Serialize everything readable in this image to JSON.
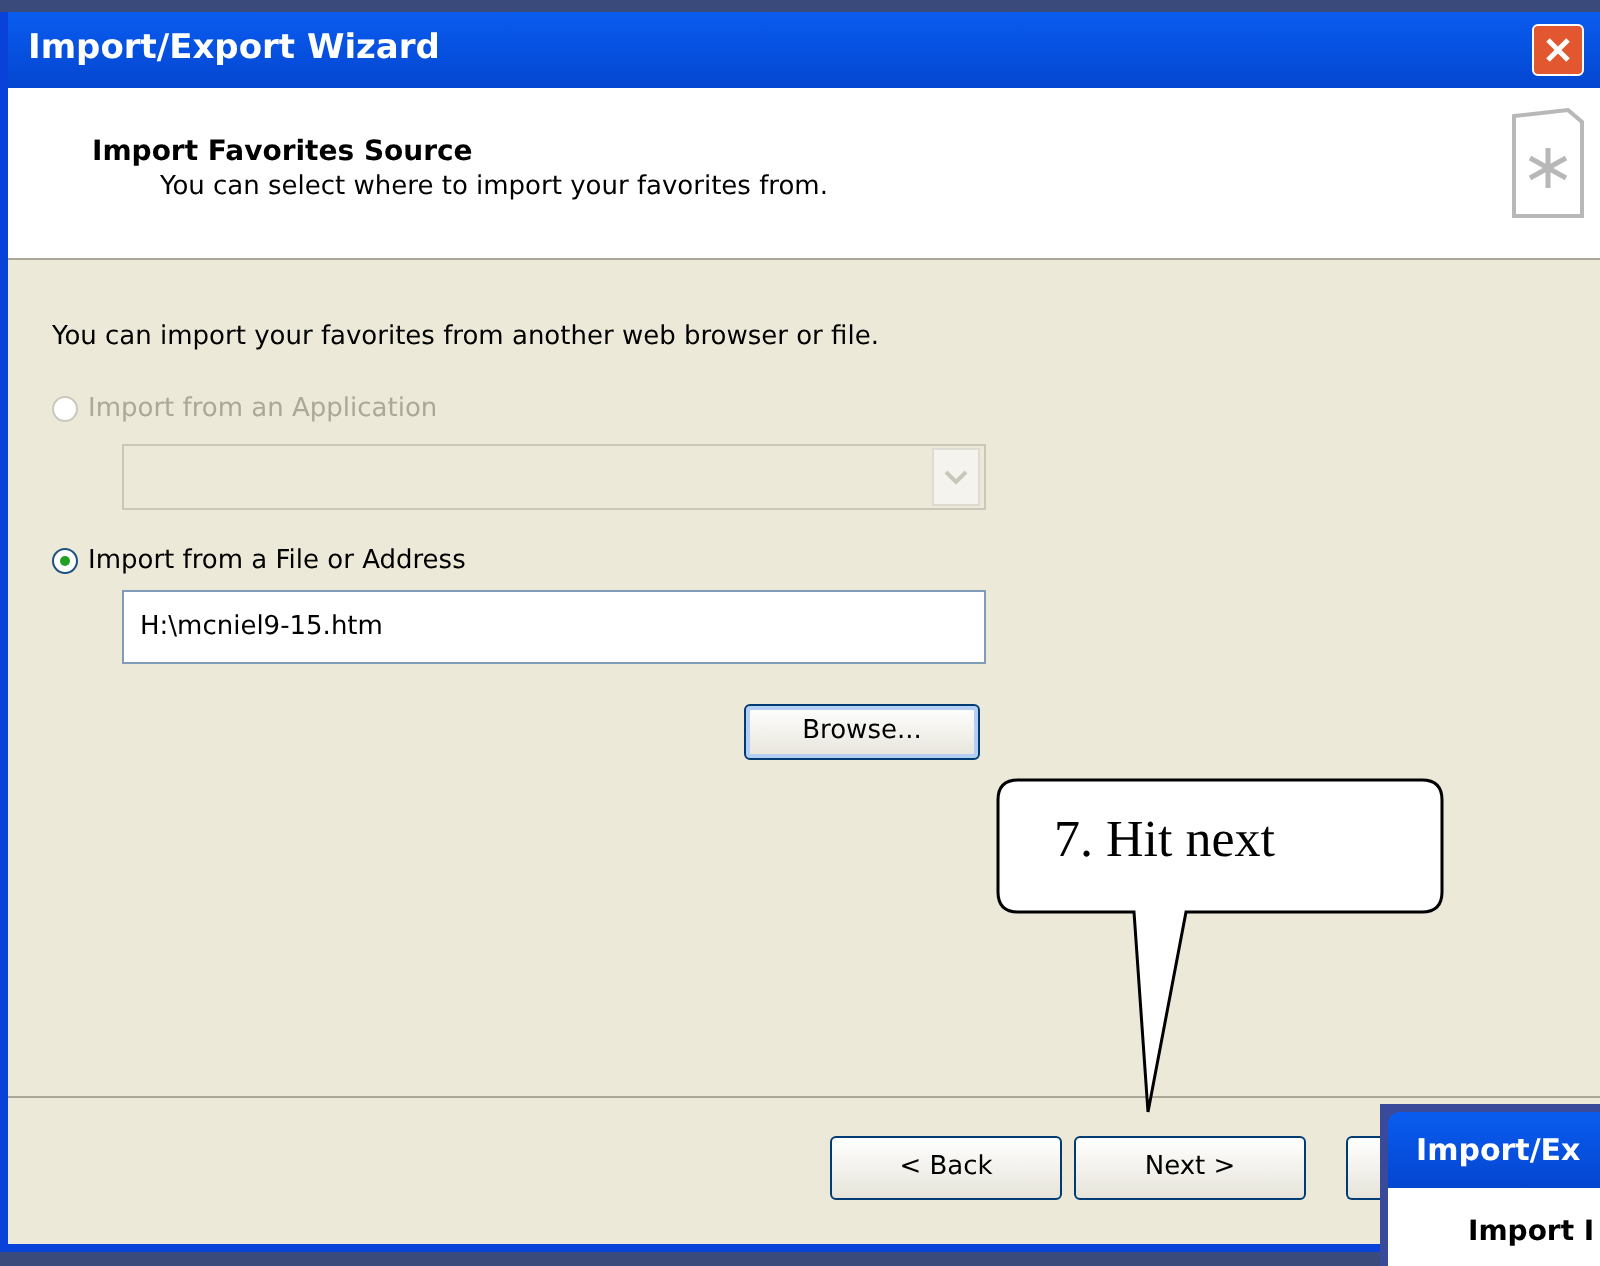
{
  "window": {
    "title": "Import/Export Wizard"
  },
  "header": {
    "title": "Import Favorites Source",
    "subtitle": "You can select where to import your favorites from."
  },
  "intro": "You can import your favorites from another web browser or file.",
  "options": [
    {
      "label": "Import from an Application",
      "selected": false,
      "disabled": true,
      "kind": "dropdown"
    },
    {
      "label": "Import from a File or Address",
      "selected": true,
      "disabled": false,
      "kind": "text",
      "value": "H:\\mcniel9-15.htm"
    }
  ],
  "browse_button": "Browse...",
  "buttons": [
    {
      "label": "< Back"
    },
    {
      "label": "Next >"
    }
  ],
  "callout": {
    "text": "7. Hit next"
  },
  "second_window": {
    "title": "Import/Ex",
    "heading": "Import I"
  }
}
